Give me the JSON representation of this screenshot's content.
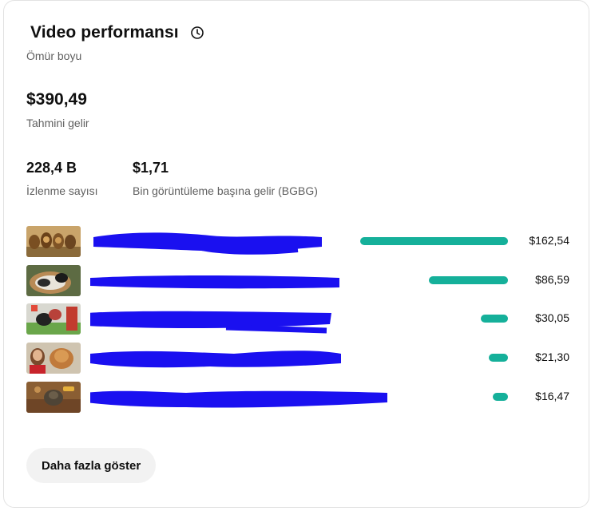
{
  "header": {
    "title": "Video performansı",
    "period": "Ömür boyu",
    "info_icon": "clock-icon"
  },
  "revenue": {
    "value": "$390,49",
    "label": "Tahmini gelir"
  },
  "metrics": {
    "views_value": "228,4 B",
    "views_label": "İzlenme sayısı",
    "rpm_value": "$1,71",
    "rpm_label": "Bin görüntüleme başına gelir (BGBG)"
  },
  "videos": [
    {
      "amount": "$162,54",
      "share": 1.0,
      "thumb": "lions"
    },
    {
      "amount": "$86,59",
      "share": 0.533,
      "thumb": "cat-basket"
    },
    {
      "amount": "$30,05",
      "share": 0.185,
      "thumb": "dog-outdoor"
    },
    {
      "amount": "$21,30",
      "share": 0.131,
      "thumb": "woman-cat"
    },
    {
      "amount": "$16,47",
      "share": 0.101,
      "thumb": "cat-toy"
    }
  ],
  "colors": {
    "bar": "#15b09a",
    "redaction": "#1a10f0"
  },
  "actions": {
    "show_more": "Daha fazla göster"
  }
}
